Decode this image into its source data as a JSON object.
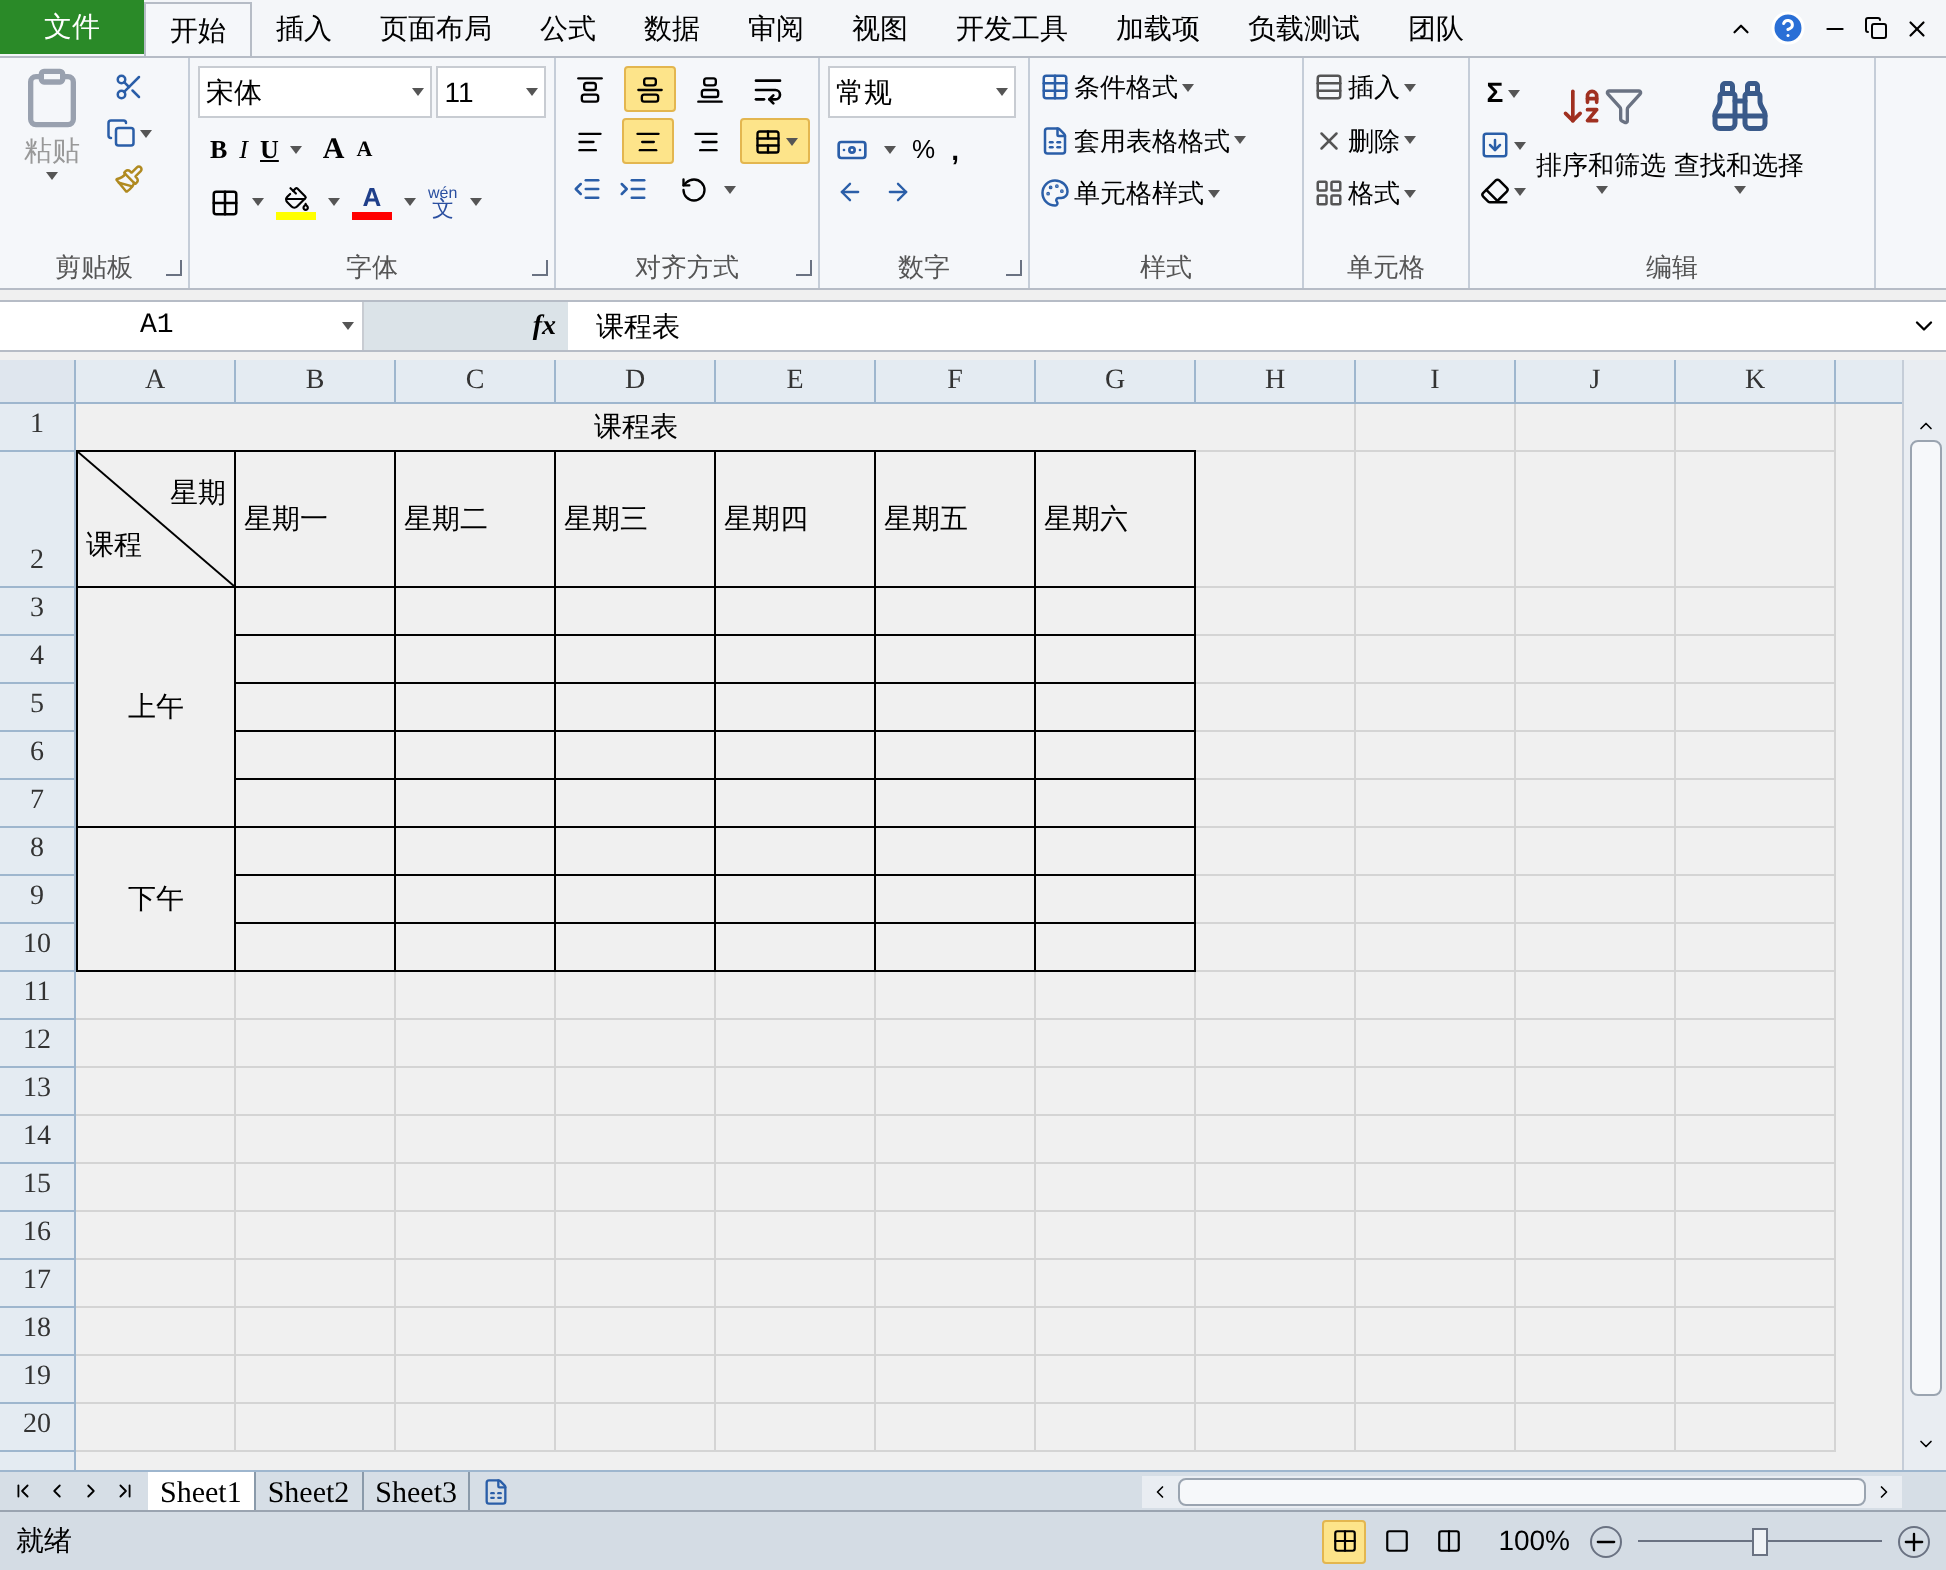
{
  "ribbon_tabs": [
    {
      "label": "文件",
      "kind": "file",
      "selected": false
    },
    {
      "label": "开始",
      "kind": "tab",
      "selected": true
    },
    {
      "label": "插入",
      "kind": "tab",
      "selected": false
    },
    {
      "label": "页面布局",
      "kind": "tab",
      "selected": false
    },
    {
      "label": "公式",
      "kind": "tab",
      "selected": false
    },
    {
      "label": "数据",
      "kind": "tab",
      "selected": false
    },
    {
      "label": "审阅",
      "kind": "tab",
      "selected": false
    },
    {
      "label": "视图",
      "kind": "tab",
      "selected": false
    },
    {
      "label": "开发工具",
      "kind": "tab",
      "selected": false
    },
    {
      "label": "加载项",
      "kind": "tab",
      "selected": false
    },
    {
      "label": "负载测试",
      "kind": "tab",
      "selected": false
    },
    {
      "label": "团队",
      "kind": "tab",
      "selected": false
    }
  ],
  "clipboard": {
    "paste": "粘贴",
    "label": "剪贴板"
  },
  "font": {
    "name": "宋体",
    "size": "11",
    "bold": "B",
    "italic": "I",
    "underline": "U",
    "grow": "A",
    "shrink": "A",
    "font_color": "A",
    "phonetic_top": "wén",
    "phonetic_bottom": "文",
    "label": "字体"
  },
  "alignment": {
    "vertical": [
      {
        "kind": "top",
        "selected": false
      },
      {
        "kind": "middle",
        "selected": true
      },
      {
        "kind": "bottom",
        "selected": false
      }
    ],
    "horizontal": [
      {
        "kind": "left",
        "selected": false
      },
      {
        "kind": "center",
        "selected": true
      },
      {
        "kind": "right",
        "selected": false
      }
    ],
    "merge_selected": true,
    "label": "对齐方式"
  },
  "number": {
    "format": "常规",
    "percent": "%",
    "comma": ",",
    "label": "数字"
  },
  "styles": {
    "items": [
      "条件格式",
      "套用表格格式",
      "单元格样式"
    ],
    "label": "样式"
  },
  "cells": {
    "items": [
      "插入",
      "删除",
      "格式"
    ],
    "label": "单元格"
  },
  "editing": {
    "sum": "Σ",
    "sort": "排序和筛选",
    "find": "查找和选择",
    "label": "编辑"
  },
  "formula_bar": {
    "name_box": "A1",
    "fx": "fx",
    "content": "课程表"
  },
  "sheet": {
    "columns": [
      "A",
      "B",
      "C",
      "D",
      "E",
      "F",
      "G",
      "H",
      "I",
      "J",
      "K"
    ],
    "rows": [
      "1",
      "2",
      "3",
      "4",
      "5",
      "6",
      "7",
      "8",
      "9",
      "10",
      "11",
      "12",
      "13",
      "14",
      "15",
      "16",
      "17",
      "18",
      "19",
      "20"
    ],
    "title": "课程表",
    "corner_top": "星期",
    "corner_bottom": "课程",
    "days": [
      "星期一",
      "星期二",
      "星期三",
      "星期四",
      "星期五",
      "星期六"
    ],
    "sessions": [
      "上午",
      "下午"
    ]
  },
  "sheet_tabs": [
    {
      "label": "Sheet1",
      "selected": true
    },
    {
      "label": "Sheet2",
      "selected": false
    },
    {
      "label": "Sheet3",
      "selected": false
    }
  ],
  "status_bar": {
    "text": "就绪",
    "views": [
      {
        "kind": "normal",
        "selected": true
      },
      {
        "kind": "layout",
        "selected": false
      },
      {
        "kind": "break",
        "selected": false
      }
    ],
    "zoom": "100%",
    "zoom_slider": {
      "level": 0.5
    }
  }
}
